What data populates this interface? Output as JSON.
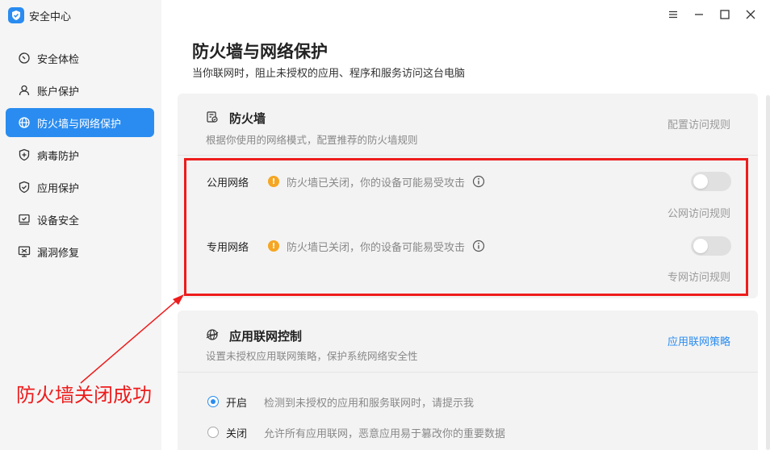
{
  "app": {
    "title": "安全中心",
    "icon": "shield-logo-icon",
    "accent": "#2a8cf0"
  },
  "window_controls": [
    {
      "name": "menu-icon"
    },
    {
      "name": "minimize-icon"
    },
    {
      "name": "maximize-icon"
    },
    {
      "name": "close-icon"
    }
  ],
  "sidebar": {
    "items": [
      {
        "label": "安全体检",
        "icon": "checkup-icon",
        "active": false
      },
      {
        "label": "账户保护",
        "icon": "user-icon",
        "active": false
      },
      {
        "label": "防火墙与网络保护",
        "icon": "globe-icon",
        "active": true
      },
      {
        "label": "病毒防护",
        "icon": "shield-plus-icon",
        "active": false
      },
      {
        "label": "应用保护",
        "icon": "shield-check-icon",
        "active": false
      },
      {
        "label": "设备安全",
        "icon": "device-check-icon",
        "active": false
      },
      {
        "label": "漏洞修复",
        "icon": "monitor-repair-icon",
        "active": false
      }
    ]
  },
  "main": {
    "title": "防火墙与网络保护",
    "subtitle": "当你联网时，阻止未授权的应用、程序和服务访问这台电脑",
    "firewall": {
      "title": "防火墙",
      "desc": "根据你使用的网络模式，配置推荐的防火墙规则",
      "link": "配置访问规则",
      "rows": [
        {
          "label": "公用网络",
          "status": "防火墙已关闭，你的设备可能易受攻击",
          "enabled": false,
          "link": "公网访问规则"
        },
        {
          "label": "专用网络",
          "status": "防火墙已关闭，你的设备可能易受攻击",
          "enabled": false,
          "link": "专网访问规则"
        }
      ]
    },
    "app_control": {
      "title": "应用联网控制",
      "desc": "设置未授权应用联网策略，保护系统网络安全性",
      "link": "应用联网策略",
      "options": [
        {
          "label": "开启",
          "desc": "检测到未授权的应用和服务联网时，请提示我",
          "checked": true
        },
        {
          "label": "关闭",
          "desc": "允许所有应用联网，恶意应用易于篡改你的重要数据",
          "checked": false
        }
      ]
    }
  },
  "annotation": {
    "text": "防火墙关闭成功",
    "color": "#ee1c1c"
  }
}
